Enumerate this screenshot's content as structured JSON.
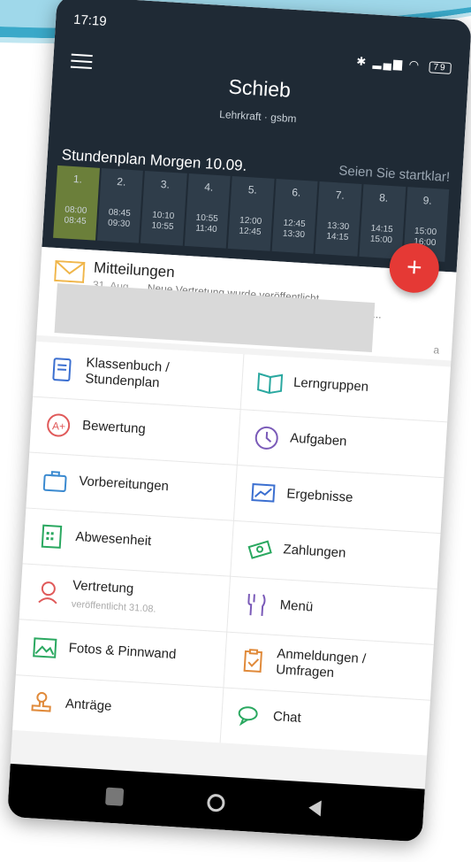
{
  "status": {
    "time": "17:19",
    "battery": "79"
  },
  "header": {
    "title": "Schieb",
    "subtitle": "Lehrkraft · gsbm"
  },
  "schedule": {
    "title": "Stundenplan Morgen 10.09.",
    "note": "Seien Sie startklar!",
    "periods": [
      {
        "num": "1.",
        "start": "08:00",
        "end": "08:45"
      },
      {
        "num": "2.",
        "start": "08:45",
        "end": "09:30"
      },
      {
        "num": "3.",
        "start": "10:10",
        "end": "10:55"
      },
      {
        "num": "4.",
        "start": "10:55",
        "end": "11:40"
      },
      {
        "num": "5.",
        "start": "12:00",
        "end": "12:45"
      },
      {
        "num": "6.",
        "start": "12:45",
        "end": "13:30"
      },
      {
        "num": "7.",
        "start": "13:30",
        "end": "14:15"
      },
      {
        "num": "8.",
        "start": "14:15",
        "end": "15:00"
      },
      {
        "num": "9.",
        "start": "15:00",
        "end": "16:00"
      }
    ]
  },
  "messages": {
    "title": "Mitteilungen",
    "date": "31. Aug",
    "text1": "Neue Vertretung wurde veröffentlicht",
    "text2": "Änderungen: Mon 02.09., Die 03.09., Mit 04.09.,...",
    "cut": "a"
  },
  "fab": {
    "label": "+"
  },
  "tiles": [
    {
      "label": "Klassenbuch / Stundenplan",
      "icon": "book-icon"
    },
    {
      "label": "Lerngruppen",
      "icon": "open-book-icon"
    },
    {
      "label": "Bewertung",
      "icon": "grade-icon"
    },
    {
      "label": "Aufgaben",
      "icon": "clock-icon"
    },
    {
      "label": "Vorbereitungen",
      "icon": "briefcase-icon"
    },
    {
      "label": "Ergebnisse",
      "icon": "chart-icon"
    },
    {
      "label": "Abwesenheit",
      "icon": "calendar-icon"
    },
    {
      "label": "Zahlungen",
      "icon": "money-icon"
    },
    {
      "label": "Vertretung",
      "sub": "veröffentlicht 31.08.",
      "icon": "person-icon"
    },
    {
      "label": "Menü",
      "icon": "cutlery-icon"
    },
    {
      "label": "Fotos & Pinnwand",
      "icon": "photo-icon"
    },
    {
      "label": "Anmeldungen / Umfragen",
      "icon": "clipboard-icon"
    },
    {
      "label": "Anträge",
      "icon": "stamp-icon"
    },
    {
      "label": "Chat",
      "icon": "chat-icon"
    }
  ],
  "colors": {
    "header": "#1f2a35",
    "active_period": "#6b7f3a",
    "fab": "#e53935"
  }
}
